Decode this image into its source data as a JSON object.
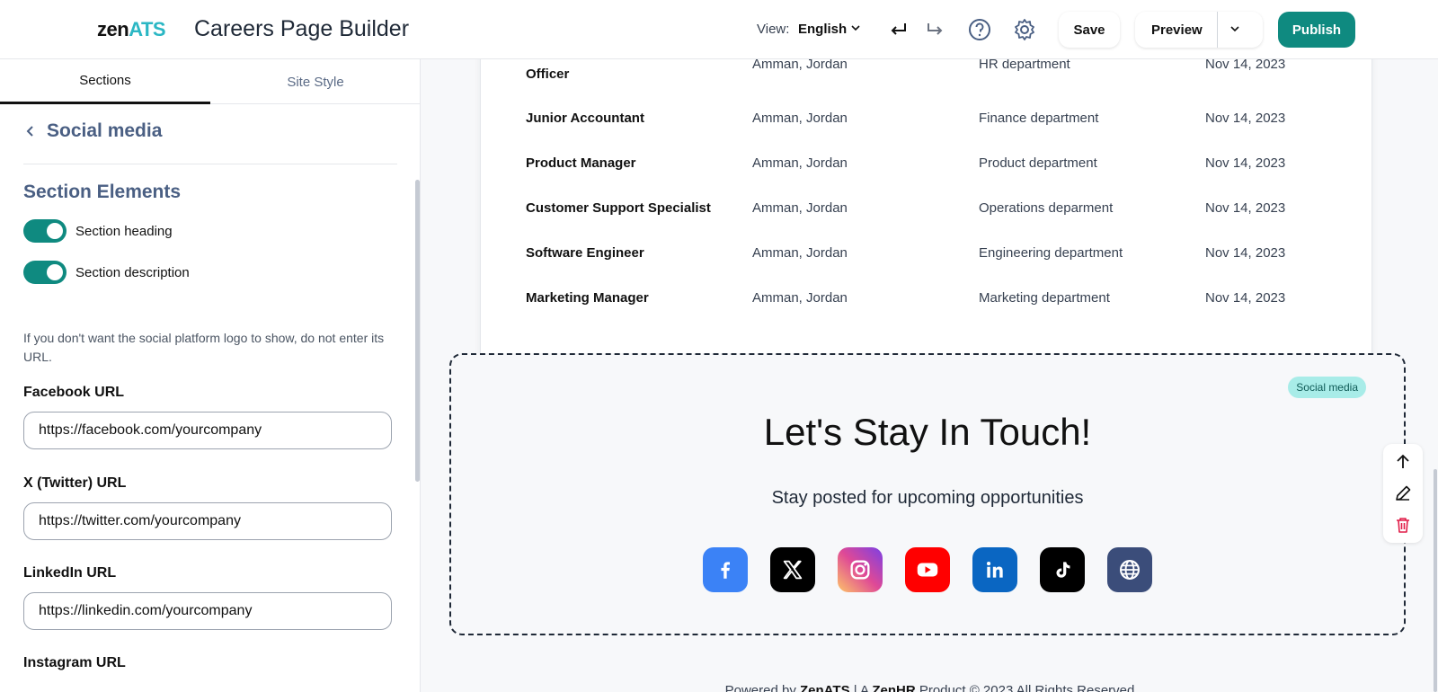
{
  "header": {
    "logo_main": "zen",
    "logo_accent": "ATS",
    "title": "Careers Page Builder",
    "view_label": "View:",
    "language": "English",
    "save_label": "Save",
    "preview_label": "Preview",
    "publish_label": "Publish"
  },
  "sidebar": {
    "tabs": [
      "Sections",
      "Site Style"
    ],
    "back_label": "Social media",
    "section_elements_title": "Section Elements",
    "toggles": [
      {
        "label": "Section heading",
        "on": true
      },
      {
        "label": "Section description",
        "on": true
      }
    ],
    "hint": "If you don't want the social platform logo to show, do not enter its URL.",
    "fields": [
      {
        "label": "Facebook URL",
        "value": "https://facebook.com/yourcompany"
      },
      {
        "label": "X (Twitter) URL",
        "value": "https://twitter.com/yourcompany"
      },
      {
        "label": "LinkedIn URL",
        "value": "https://linkedin.com/yourcompany"
      },
      {
        "label": "Instagram URL",
        "value": ""
      }
    ]
  },
  "jobs": [
    {
      "title": "Officer",
      "location": "Amman, Jordan",
      "department": "HR department",
      "date": "Nov 14, 2023"
    },
    {
      "title": "Junior Accountant",
      "location": "Amman, Jordan",
      "department": "Finance department",
      "date": "Nov 14, 2023"
    },
    {
      "title": "Product Manager",
      "location": "Amman, Jordan",
      "department": "Product department",
      "date": "Nov 14, 2023"
    },
    {
      "title": "Customer Support Specialist",
      "location": "Amman, Jordan",
      "department": "Operations deparment",
      "date": "Nov 14, 2023"
    },
    {
      "title": "Software Engineer",
      "location": "Amman, Jordan",
      "department": "Engineering department",
      "date": "Nov 14, 2023"
    },
    {
      "title": "Marketing Manager",
      "location": "Amman, Jordan",
      "department": "Marketing department",
      "date": "Nov 14, 2023"
    }
  ],
  "social": {
    "badge": "Social media",
    "heading": "Let's Stay In Touch!",
    "description": "Stay posted for upcoming opportunities",
    "icons": [
      {
        "name": "facebook-icon",
        "color": "#3b82f6"
      },
      {
        "name": "x-twitter-icon",
        "color": "#000000"
      },
      {
        "name": "instagram-icon",
        "color": "#d6249f"
      },
      {
        "name": "youtube-icon",
        "color": "#ff0000"
      },
      {
        "name": "linkedin-icon",
        "color": "#0a66c2"
      },
      {
        "name": "tiktok-icon",
        "color": "#000000"
      },
      {
        "name": "website-icon",
        "color": "#3b4d7a"
      }
    ]
  },
  "footer": {
    "prefix": "Powered by ",
    "brand": "ZenATS",
    "middle": " | A ",
    "company": "ZenHR",
    "suffix": " Product © 2023 All Rights Reserved"
  },
  "colors": {
    "accent": "#0f8a80",
    "heading_blue": "#4a5f83"
  }
}
